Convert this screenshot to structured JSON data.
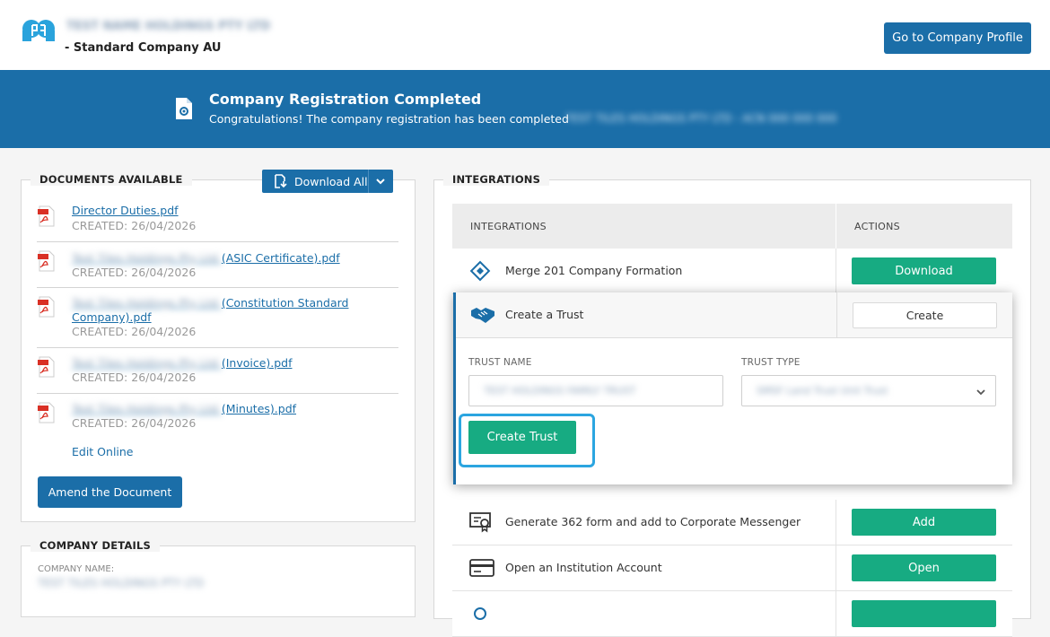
{
  "header": {
    "company_name": "TEST NAME HOLDINGS PTY LTD",
    "company_type": "- Standard Company AU",
    "profile_button": "Go to Company Profile"
  },
  "banner": {
    "title": "Company Registration Completed",
    "message": "Congratulations! The company registration has been completed",
    "company_ref": "TEST TILES HOLDINGS PTY LTD - ACN 000 000 000"
  },
  "documents": {
    "legend": "DOCUMENTS AVAILABLE",
    "download_all": "Download All",
    "items": [
      {
        "prefix": "",
        "name": "Director Duties.pdf",
        "created": "CREATED: 26/04/2026"
      },
      {
        "prefix": "Test Tiles Holdings Pty Ltd ",
        "name": "(ASIC Certificate).pdf",
        "created": "CREATED: 26/04/2026"
      },
      {
        "prefix": "Test Tiles Holdings Pty Ltd ",
        "name": "(Constitution Standard",
        "name2": "Company).pdf",
        "created": "CREATED: 26/04/2026"
      },
      {
        "prefix": "Test Tiles Holdings Pty Ltd ",
        "name": "(Invoice).pdf",
        "created": "CREATED: 26/04/2026"
      },
      {
        "prefix": "Test Tiles Holdings Pty Ltd ",
        "name": "(Minutes).pdf",
        "created": "CREATED: 26/04/2026"
      }
    ],
    "edit_online": "Edit Online",
    "amend_button": "Amend the Document"
  },
  "company_details": {
    "legend": "COMPANY DETAILS",
    "name_label": "COMPANY NAME:",
    "name_value": "TEST TILES HOLDINGS PTY LTD"
  },
  "integrations": {
    "legend": "INTEGRATIONS",
    "col_integrations": "INTEGRATIONS",
    "col_actions": "ACTIONS",
    "rows": [
      {
        "label": "Merge 201 Company Formation",
        "action": "Download",
        "icon": "merge-icon"
      },
      {
        "label": "Generate 362 form and add to Corporate Messenger",
        "action": "Add",
        "icon": "certificate-icon"
      },
      {
        "label": "Open an Institution Account",
        "action": "Open",
        "icon": "card-icon"
      }
    ],
    "trust": {
      "label": "Create a Trust",
      "action": "Create",
      "trust_name_label": "TRUST NAME",
      "trust_name_value": "TEST HOLDINGS FAMILY TRUST",
      "trust_type_label": "TRUST TYPE",
      "trust_type_value": "SMSF Land Trust Unit Trust",
      "submit": "Create Trust"
    }
  },
  "colors": {
    "primary": "#1b6ea8",
    "success": "#17ab82",
    "focus": "#2ba5e0"
  }
}
